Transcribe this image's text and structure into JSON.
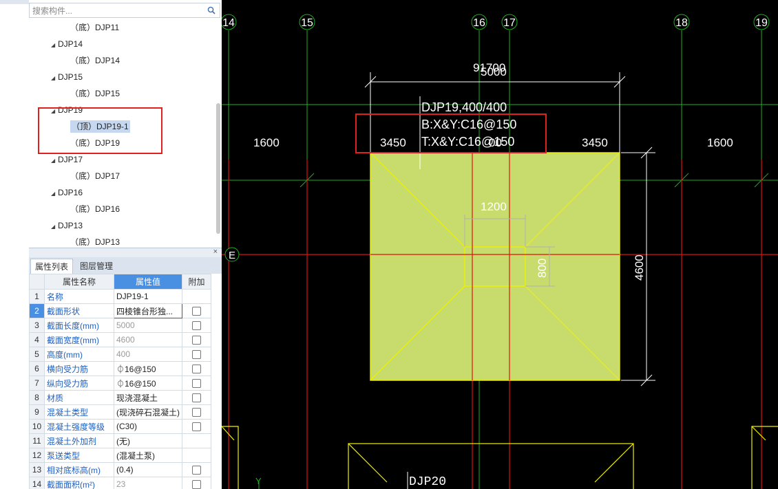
{
  "search": {
    "placeholder": "搜索构件..."
  },
  "tree": {
    "items": [
      {
        "label": "（底）DJP11",
        "level": 2
      },
      {
        "label": "DJP14",
        "level": 1
      },
      {
        "label": "（底）DJP14",
        "level": 2
      },
      {
        "label": "DJP15",
        "level": 1
      },
      {
        "label": "（底）DJP15",
        "level": 2
      },
      {
        "label": "DJP19",
        "level": 1
      },
      {
        "label": "（顶）DJP19-1",
        "level": 2,
        "selected": true
      },
      {
        "label": "（底）DJP19",
        "level": 2
      },
      {
        "label": "DJP17",
        "level": 1
      },
      {
        "label": "（底）DJP17",
        "level": 2
      },
      {
        "label": "DJP16",
        "level": 1
      },
      {
        "label": "（底）DJP16",
        "level": 2
      },
      {
        "label": "DJP13",
        "level": 1
      },
      {
        "label": "（底）DJP13",
        "level": 2
      }
    ]
  },
  "tabs": {
    "props": "属性列表",
    "layers": "图层管理"
  },
  "props": {
    "headers": {
      "name": "属性名称",
      "value": "属性值",
      "extra": "附加"
    },
    "rows": [
      {
        "num": "1",
        "name": "名称",
        "value": "DJP19-1",
        "gray": false,
        "check": false
      },
      {
        "num": "2",
        "name": "截面形状",
        "value": "四棱锥台形独...",
        "gray": false,
        "check": true
      },
      {
        "num": "3",
        "name": "截面长度(mm)",
        "value": "5000",
        "gray": true,
        "check": true
      },
      {
        "num": "4",
        "name": "截面宽度(mm)",
        "value": "4600",
        "gray": true,
        "check": true
      },
      {
        "num": "5",
        "name": "高度(mm)",
        "value": "400",
        "gray": true,
        "check": true
      },
      {
        "num": "6",
        "name": "横向受力筋",
        "value": "⏀16@150",
        "gray": false,
        "check": true
      },
      {
        "num": "7",
        "name": "纵向受力筋",
        "value": "⏀16@150",
        "gray": false,
        "check": true
      },
      {
        "num": "8",
        "name": "材质",
        "value": "现浇混凝土",
        "gray": false,
        "check": true
      },
      {
        "num": "9",
        "name": "混凝土类型",
        "value": "(现浇碎石混凝土)",
        "gray": false,
        "check": true
      },
      {
        "num": "10",
        "name": "混凝土强度等级",
        "value": "(C30)",
        "gray": false,
        "check": true
      },
      {
        "num": "11",
        "name": "混凝土外加剂",
        "value": "(无)",
        "gray": false,
        "check": false
      },
      {
        "num": "12",
        "name": "泵送类型",
        "value": "(混凝土泵)",
        "gray": false,
        "check": false
      },
      {
        "num": "13",
        "name": "相对底标高(m)",
        "value": "(0.4)",
        "gray": false,
        "check": true
      },
      {
        "num": "14",
        "name": "截面面积(m²)",
        "value": "23",
        "gray": true,
        "check": true
      }
    ]
  },
  "cad": {
    "axes": [
      "14",
      "15",
      "16",
      "17",
      "18",
      "19"
    ],
    "axis_e": "E",
    "axis_y": "Y",
    "dims": {
      "top_a": "91700",
      "top_b": "5000",
      "left_outer": "1600",
      "left_inner": "3450",
      "mid_partial": "00",
      "right_inner": "3450",
      "right_outer": "1600",
      "inner_width": "1200",
      "inner_height": "800",
      "height": "4600"
    },
    "annotation": {
      "line1": "DJP19,400/400",
      "line2": "B:X&Y:C16@150",
      "line3": "T:X&Y:C16@150"
    },
    "bottom_label": "DJP20",
    "colors": {
      "footing_fill": "#c8dc6e",
      "footing_edge": "#f0f000",
      "axis_red": "#e01010",
      "grid_green": "#1fb01f",
      "highlight_red": "#e0201c"
    }
  }
}
